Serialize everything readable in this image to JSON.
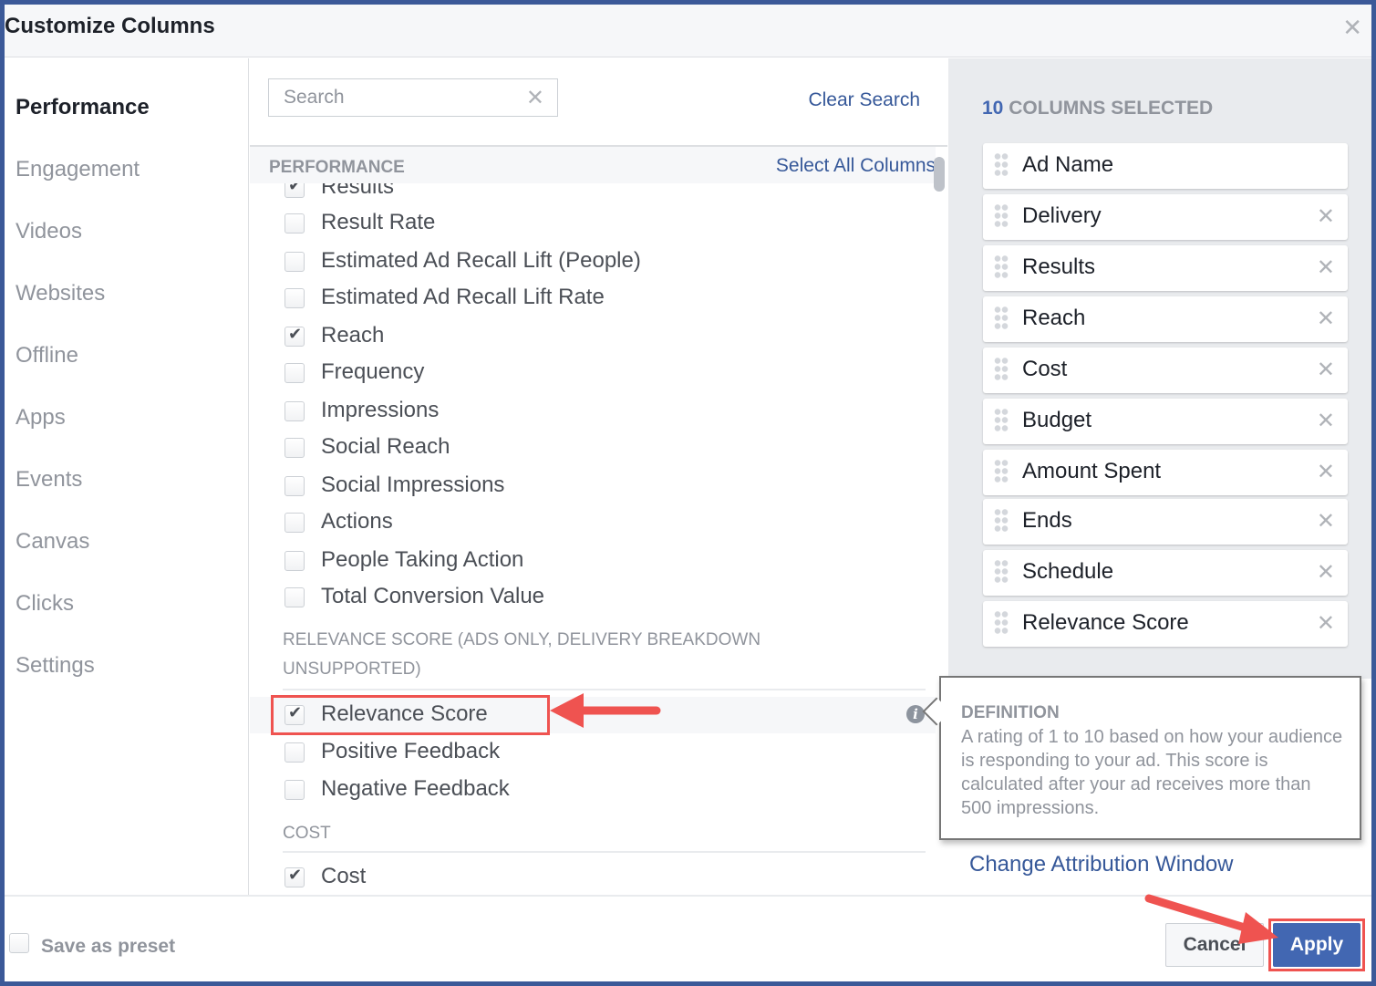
{
  "dialog": {
    "title": "Customize Columns",
    "close_icon": "close-icon"
  },
  "nav": {
    "items": [
      {
        "label": "Performance",
        "active": true
      },
      {
        "label": "Engagement",
        "active": false
      },
      {
        "label": "Videos",
        "active": false
      },
      {
        "label": "Websites",
        "active": false
      },
      {
        "label": "Offline",
        "active": false
      },
      {
        "label": "Apps",
        "active": false
      },
      {
        "label": "Events",
        "active": false
      },
      {
        "label": "Canvas",
        "active": false
      },
      {
        "label": "Clicks",
        "active": false
      },
      {
        "label": "Settings",
        "active": false
      }
    ]
  },
  "search": {
    "placeholder": "Search",
    "value": "",
    "clear_label": "Clear Search"
  },
  "section": {
    "title": "PERFORMANCE",
    "select_all_label": "Select All Columns"
  },
  "options": {
    "performance": [
      {
        "label": "Results",
        "checked": true
      },
      {
        "label": "Result Rate",
        "checked": false
      },
      {
        "label": "Estimated Ad Recall Lift (People)",
        "checked": false
      },
      {
        "label": "Estimated Ad Recall Lift Rate",
        "checked": false
      },
      {
        "label": "Reach",
        "checked": true
      },
      {
        "label": "Frequency",
        "checked": false
      },
      {
        "label": "Impressions",
        "checked": false
      },
      {
        "label": "Social Reach",
        "checked": false
      },
      {
        "label": "Social Impressions",
        "checked": false
      },
      {
        "label": "Actions",
        "checked": false
      },
      {
        "label": "People Taking Action",
        "checked": false
      },
      {
        "label": "Total Conversion Value",
        "checked": false
      }
    ],
    "relevance_group_line1": "RELEVANCE SCORE (ADS ONLY, DELIVERY BREAKDOWN",
    "relevance_group_line2": "UNSUPPORTED)",
    "relevance": [
      {
        "label": "Relevance Score",
        "checked": true
      },
      {
        "label": "Positive Feedback",
        "checked": false
      },
      {
        "label": "Negative Feedback",
        "checked": false
      }
    ],
    "cost_group": "COST",
    "cost": [
      {
        "label": "Cost",
        "checked": true
      }
    ]
  },
  "selected": {
    "count": "10",
    "title": "COLUMNS SELECTED",
    "columns": [
      {
        "label": "Ad Name",
        "removable": false
      },
      {
        "label": "Delivery",
        "removable": true
      },
      {
        "label": "Results",
        "removable": true
      },
      {
        "label": "Reach",
        "removable": true
      },
      {
        "label": "Cost",
        "removable": true
      },
      {
        "label": "Budget",
        "removable": true
      },
      {
        "label": "Amount Spent",
        "removable": true
      },
      {
        "label": "Ends",
        "removable": true
      },
      {
        "label": "Schedule",
        "removable": true
      },
      {
        "label": "Relevance Score",
        "removable": true
      }
    ],
    "attribution_link": "Change Attribution Window"
  },
  "tooltip": {
    "title": "DEFINITION",
    "body": "A rating of 1 to 10 based on how your audience is responding to your ad. This score is calculated after your ad receives more than 500 impressions."
  },
  "footer": {
    "save_preset_label": "Save as preset",
    "save_preset_checked": false,
    "cancel_label": "Cancel",
    "apply_label": "Apply"
  },
  "colors": {
    "frame": "#3b5998",
    "accent": "#4267b2",
    "link": "#365899",
    "annotation": "#ef5350"
  }
}
